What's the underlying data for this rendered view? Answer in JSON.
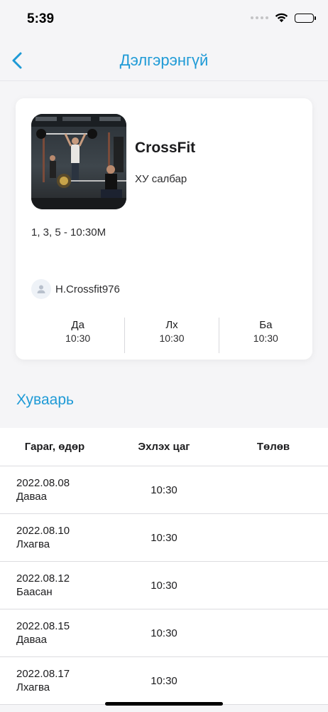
{
  "status_bar": {
    "time": "5:39"
  },
  "nav": {
    "title": "Дэлгэрэнгүй"
  },
  "class": {
    "title": "CrossFit",
    "branch": "ХУ салбар",
    "days": "1, 3, 5 - 10:30М",
    "trainer": "H.Crossfit976",
    "slots": [
      {
        "day": "Да",
        "time": "10:30"
      },
      {
        "day": "Лх",
        "time": "10:30"
      },
      {
        "day": "Ба",
        "time": "10:30"
      }
    ]
  },
  "schedule": {
    "title": "Хуваарь",
    "columns": [
      "Гараг, өдөр",
      "Эхлэх цаг",
      "Төлөв"
    ],
    "rows": [
      {
        "date": "2022.08.08",
        "weekday": "Даваа",
        "time": "10:30",
        "status": ""
      },
      {
        "date": "2022.08.10",
        "weekday": "Лхагва",
        "time": "10:30",
        "status": ""
      },
      {
        "date": "2022.08.12",
        "weekday": "Баасан",
        "time": "10:30",
        "status": ""
      },
      {
        "date": "2022.08.15",
        "weekday": "Даваа",
        "time": "10:30",
        "status": ""
      },
      {
        "date": "2022.08.17",
        "weekday": "Лхагва",
        "time": "10:30",
        "status": ""
      }
    ]
  },
  "colors": {
    "accent": "#1e9ad6",
    "background": "#f5f5f7"
  }
}
